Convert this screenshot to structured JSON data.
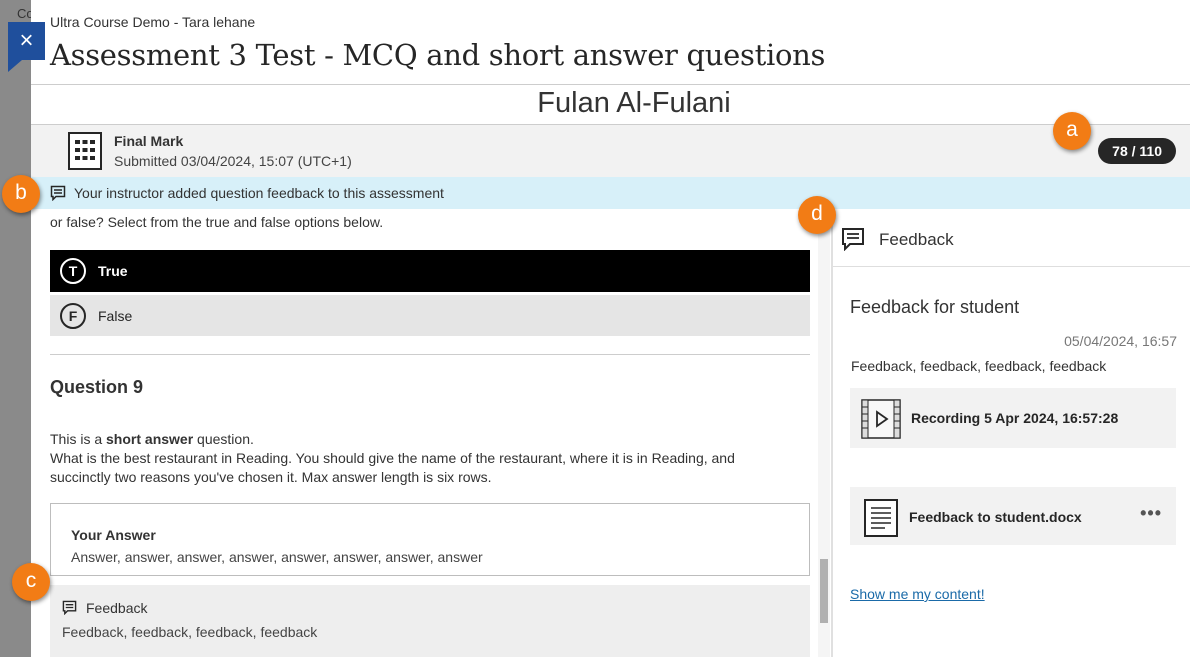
{
  "background": {
    "truncated_text": "Co"
  },
  "header": {
    "close_label": "×",
    "course_name": "Ultra Course Demo - Tara lehane",
    "title": "Assessment 3 Test - MCQ and short answer questions",
    "student_name": "Fulan Al-Fulani"
  },
  "mark": {
    "title": "Final Mark",
    "submitted": "Submitted 03/04/2024, 15:07 (UTC+1)",
    "score": "78 / 110"
  },
  "notice": {
    "text": "Your instructor added question feedback to this assessment"
  },
  "question_prev": {
    "text": "or false? Select from the true and false options below.",
    "options": [
      {
        "letter": "T",
        "label": "True",
        "selected": true
      },
      {
        "letter": "F",
        "label": "False",
        "selected": false
      }
    ]
  },
  "question9": {
    "heading": "Question 9",
    "intro_before": "This is a ",
    "intro_bold": "short answer",
    "intro_after": " question.",
    "body": "What is the best restaurant in Reading. You should give the name of the restaurant, where it is in Reading, and succinctly two reasons you've chosen it. Max answer length is six rows.",
    "answer_title": "Your Answer",
    "answer_text": "Answer, answer, answer, answer, answer, answer, answer, answer",
    "feedback_title": "Feedback",
    "feedback_text": "Feedback, feedback, feedback, feedback"
  },
  "side_panel": {
    "title": "Feedback",
    "feedback_heading": "Feedback for student",
    "date": "05/04/2024, 16:57",
    "feedback_text": "Feedback, feedback, feedback, feedback",
    "recording_label": "Recording 5 Apr 2024, 16:57:28",
    "document_label": "Feedback to student.docx",
    "more_label": "•••",
    "link_label": "Show me my content!"
  },
  "callouts": {
    "a": "a",
    "b": "b",
    "c": "c",
    "d": "d"
  },
  "colors": {
    "accent_blue": "#1f4f9c",
    "callout": "#f27c15",
    "notice_bg": "#d7f0f9",
    "link": "#1a6aa8"
  },
  "icons": {
    "close": "close-icon",
    "mark": "calculator-icon",
    "feedback": "comment-icon",
    "recording": "video-icon",
    "document": "document-icon"
  }
}
